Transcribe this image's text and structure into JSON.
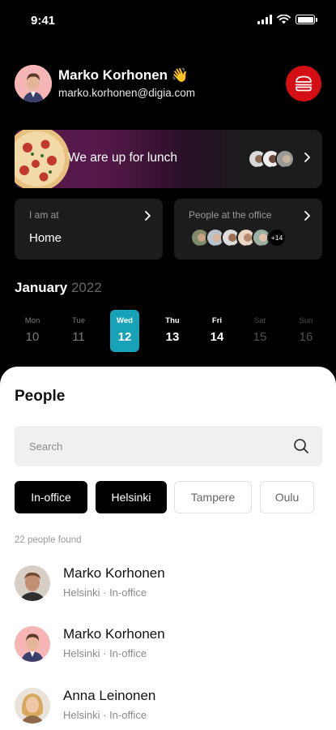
{
  "status_bar": {
    "time": "9:41"
  },
  "profile": {
    "name": "Marko Korhonen 👋",
    "email": "marko.korhonen@digia.com"
  },
  "lunch_banner": {
    "text": "We are up for lunch"
  },
  "cards": {
    "location": {
      "label": "I am at",
      "value": "Home"
    },
    "office": {
      "label": "People at the office",
      "more_count": "+14"
    }
  },
  "calendar": {
    "month": "January",
    "year": "2022",
    "days": [
      {
        "name": "Mon",
        "date": "10",
        "state": "past"
      },
      {
        "name": "Tue",
        "date": "11",
        "state": "past"
      },
      {
        "name": "Wed",
        "date": "12",
        "state": "selected"
      },
      {
        "name": "Thu",
        "date": "13",
        "state": "now"
      },
      {
        "name": "Fri",
        "date": "14",
        "state": "now"
      },
      {
        "name": "Sat",
        "date": "15",
        "state": "future"
      },
      {
        "name": "Sun",
        "date": "16",
        "state": "future"
      }
    ]
  },
  "people": {
    "title": "People",
    "search_placeholder": "Search",
    "filters": [
      {
        "label": "In-office",
        "active": true
      },
      {
        "label": "Helsinki",
        "active": true
      },
      {
        "label": "Tampere",
        "active": false
      },
      {
        "label": "Oulu",
        "active": false
      }
    ],
    "found_text": "22 people found",
    "list": [
      {
        "name": "Marko Korhonen",
        "sub": "Helsinki · In-office"
      },
      {
        "name": "Marko Korhonen",
        "sub": "Helsinki · In-office"
      },
      {
        "name": "Anna Leinonen",
        "sub": "Helsinki · In-office"
      }
    ]
  },
  "colors": {
    "accent": "#17a2b8",
    "burger_button": "#d40f14",
    "lunch_gradient_start": "#5a1950"
  }
}
